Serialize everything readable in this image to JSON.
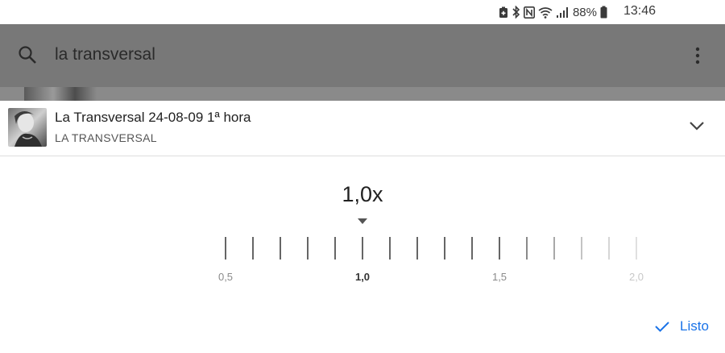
{
  "status_bar": {
    "battery_percent": "88%",
    "time": "13:46",
    "icons": [
      "battery-saver-icon",
      "bluetooth-icon",
      "nfc-icon",
      "wifi-icon",
      "signal-icon",
      "battery-icon"
    ]
  },
  "search": {
    "query": "la transversal",
    "icon": "search-icon",
    "menu_icon": "overflow-menu-icon"
  },
  "player": {
    "title": "La Transversal 24-08-09 1ª hora",
    "artist": "LA TRANSVERSAL",
    "collapse_icon": "chevron-down-icon"
  },
  "speed": {
    "current": "1,0x",
    "value": 1.0,
    "min": 0.5,
    "max": 2.0,
    "step": 0.1,
    "labels": [
      {
        "text": "0,5",
        "value": 0.5
      },
      {
        "text": "1,0",
        "value": 1.0
      },
      {
        "text": "1,5",
        "value": 1.5
      },
      {
        "text": "2,0",
        "value": 2.0
      }
    ]
  },
  "done": {
    "label": "Listo",
    "icon": "check-icon",
    "color": "#1a73e8"
  }
}
